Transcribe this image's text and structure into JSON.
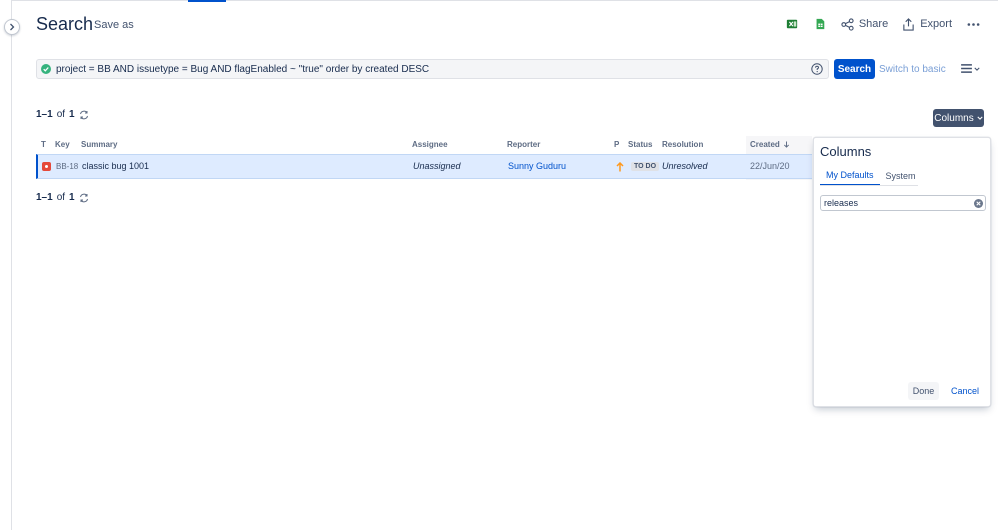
{
  "header": {
    "title": "Search",
    "save_as": "Save as",
    "share_label": "Share",
    "export_label": "Export"
  },
  "jql": {
    "query": "project = BB AND issuetype = Bug AND flagEnabled ~ \"true\" order by created DESC",
    "search_label": "Search",
    "switch_basic": "Switch to basic"
  },
  "results": {
    "range": "1–1",
    "of_label": "of",
    "total": "1"
  },
  "columns_button": "Columns",
  "table": {
    "headers": {
      "type": "T",
      "key": "Key",
      "summary": "Summary",
      "assignee": "Assignee",
      "reporter": "Reporter",
      "priority": "P",
      "status": "Status",
      "resolution": "Resolution",
      "created": "Created"
    },
    "rows": [
      {
        "type_icon": "bug-icon",
        "key": "BB-18",
        "summary": "classic bug 1001",
        "assignee": "Unassigned",
        "reporter": "Sunny Guduru",
        "priority_icon": "arrow-up-icon",
        "status": "TO DO",
        "resolution": "Unresolved",
        "created": "22/Jun/20"
      }
    ]
  },
  "columns_panel": {
    "title": "Columns",
    "tabs": [
      "My Defaults",
      "System"
    ],
    "active_tab": "My Defaults",
    "filter_value": "releases",
    "done_label": "Done",
    "cancel_label": "Cancel"
  },
  "colors": {
    "primary": "#0052cc",
    "bug": "#e5493a",
    "priority_medium": "#ff991f",
    "jql_valid": "#36b37e"
  }
}
